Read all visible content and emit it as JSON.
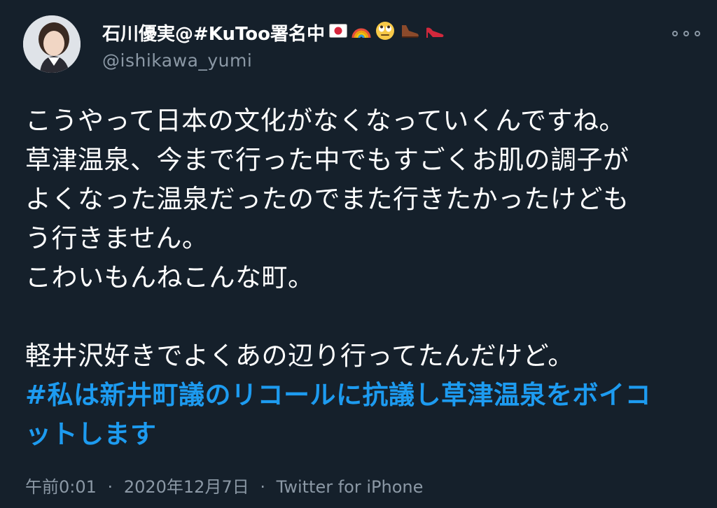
{
  "tweet": {
    "author": {
      "display_name": "石川優実@#KuToo署名中",
      "handle": "@ishikawa_yumi",
      "name_emojis": [
        "japan-flag-icon",
        "rainbow-icon",
        "rolling-eyes-emoji-icon",
        "mans-shoe-icon",
        "high-heel-icon"
      ]
    },
    "text_lines": [
      "こうやって日本の文化がなくなっていくんですね。",
      "草津温泉、今まで行った中でもすごくお肌の調子が",
      "よくなった温泉だったのでまた行きたかったけども",
      "う行きません。",
      "こわいもんねこんな町。",
      "",
      "軽井沢好きでよくあの辺り行ってたんだけど。"
    ],
    "hashtag_lines": [
      "#私は新井町議のリコールに抗議し草津温泉をボイコ",
      "ットします"
    ],
    "time": "午前0:01",
    "date": "2020年12月7日",
    "separator": "·",
    "source": "Twitter for iPhone"
  },
  "colors": {
    "background": "#15202b",
    "text": "#ffffff",
    "secondary_text": "#8b98a5",
    "link": "#1d9bf0"
  }
}
